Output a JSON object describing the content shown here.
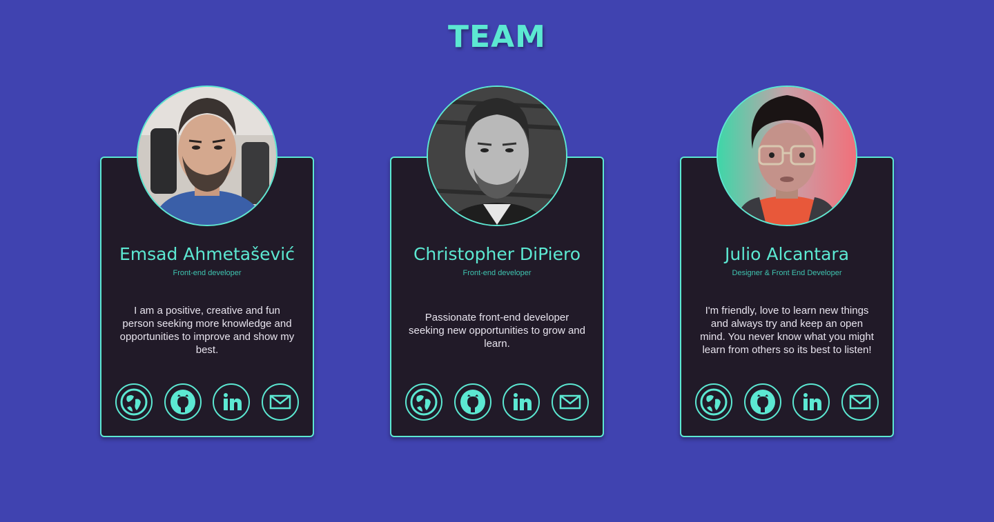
{
  "page": {
    "title": "TEAM"
  },
  "colors": {
    "background": "#4043b0",
    "accent": "#5ce8d2",
    "card": "#211a28",
    "text": "#e8e4ee"
  },
  "social_icons": [
    "website-globe-icon",
    "github-icon",
    "linkedin-icon",
    "email-envelope-icon"
  ],
  "team": [
    {
      "name": "Emsad Ahmetašević",
      "role": "Front-end developer",
      "bio": "I am a positive, creative and fun person seeking more knowledge and opportunities to improve and show my best."
    },
    {
      "name": "Christopher DiPiero",
      "role": "Front-end developer",
      "bio": "Passionate front-end developer seeking new opportunities to grow and learn."
    },
    {
      "name": "Julio Alcantara",
      "role": "Designer & Front End Developer",
      "bio": "I'm friendly, love to learn new things and always try and keep an open mind. You never know what you might learn from others so its best to listen!"
    }
  ]
}
